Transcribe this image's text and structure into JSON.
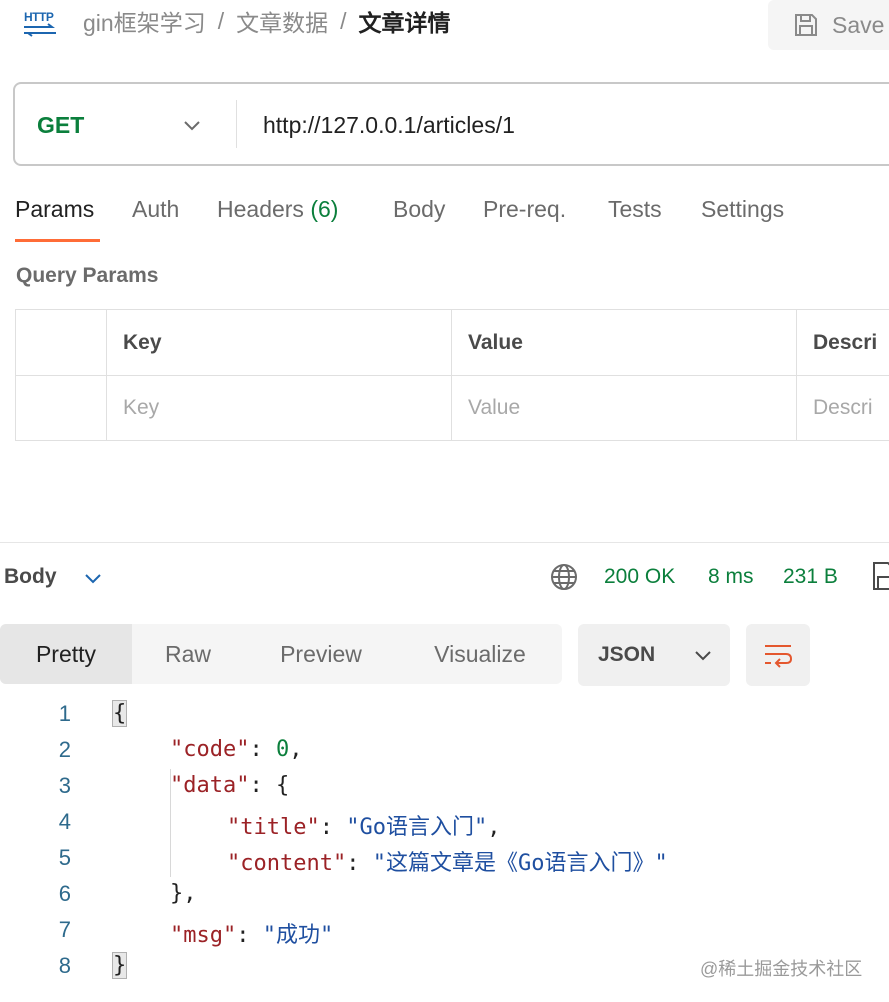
{
  "header": {
    "http_badge": "HTTP",
    "breadcrumb": [
      "gin框架学习",
      "文章数据",
      "文章详情"
    ],
    "separator": "/",
    "save_label": "Save"
  },
  "request": {
    "method": "GET",
    "url": "http://127.0.0.1/articles/1"
  },
  "request_tabs": [
    {
      "label": "Params",
      "active": true
    },
    {
      "label": "Auth"
    },
    {
      "label": "Headers",
      "count": "(6)"
    },
    {
      "label": "Body"
    },
    {
      "label": "Pre-req."
    },
    {
      "label": "Tests"
    },
    {
      "label": "Settings"
    }
  ],
  "query_params": {
    "title": "Query Params",
    "columns": [
      "Key",
      "Value",
      "Descri"
    ],
    "placeholders": [
      "Key",
      "Value",
      "Descri"
    ]
  },
  "response": {
    "body_label": "Body",
    "status": "200 OK",
    "time": "8 ms",
    "size": "231 B",
    "view_modes": [
      "Pretty",
      "Raw",
      "Preview",
      "Visualize"
    ],
    "active_view": "Pretty",
    "format": "JSON",
    "line_numbers": [
      "1",
      "2",
      "3",
      "4",
      "5",
      "6",
      "7",
      "8"
    ],
    "json": {
      "code_key": "\"code\"",
      "code_value": "0",
      "data_key": "\"data\"",
      "title_key": "\"title\"",
      "title_value": "\"Go语言入门\"",
      "content_key": "\"content\"",
      "content_value": "\"这篇文章是《Go语言入门》\"",
      "msg_key": "\"msg\"",
      "msg_value": "\"成功\""
    }
  },
  "watermark": "@稀土掘金技术社区",
  "colors": {
    "accent": "#ff6c37",
    "method_get": "#0b7f3c",
    "status_ok": "#0b7f3c",
    "json_key": "#9b2226",
    "json_string": "#1f4fa0"
  }
}
